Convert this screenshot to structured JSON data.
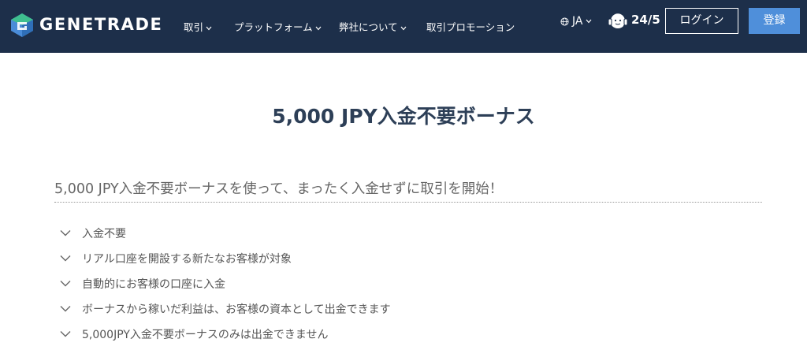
{
  "header": {
    "brand": "GENETRADE",
    "nav": [
      {
        "label": "取引"
      },
      {
        "label": "プラットフォーム"
      },
      {
        "label": "弊社について"
      },
      {
        "label": "取引プロモーション"
      }
    ],
    "language": "JA",
    "support_label": "24/5",
    "login_label": "ログイン",
    "register_label": "登録"
  },
  "main": {
    "title": "5,000 JPY入金不要ボーナス",
    "subtitle": "5,000 JPY入金不要ボーナスを使って、まったく入金せずに取引を開始！",
    "features": [
      "入金不要",
      "リアル口座を開設する新たなお客様が対象",
      "自動的にお客様の口座に入金",
      "ボーナスから稼いだ利益は、お客様の資本として出金できます",
      "5,000JPY入金不要ボーナスのみは出金できません"
    ]
  },
  "colors": {
    "header_bg": "#1d2f4a",
    "accent": "#4f8fda",
    "logo_green": "#3fbf8f",
    "logo_blue": "#4a8cd8"
  }
}
